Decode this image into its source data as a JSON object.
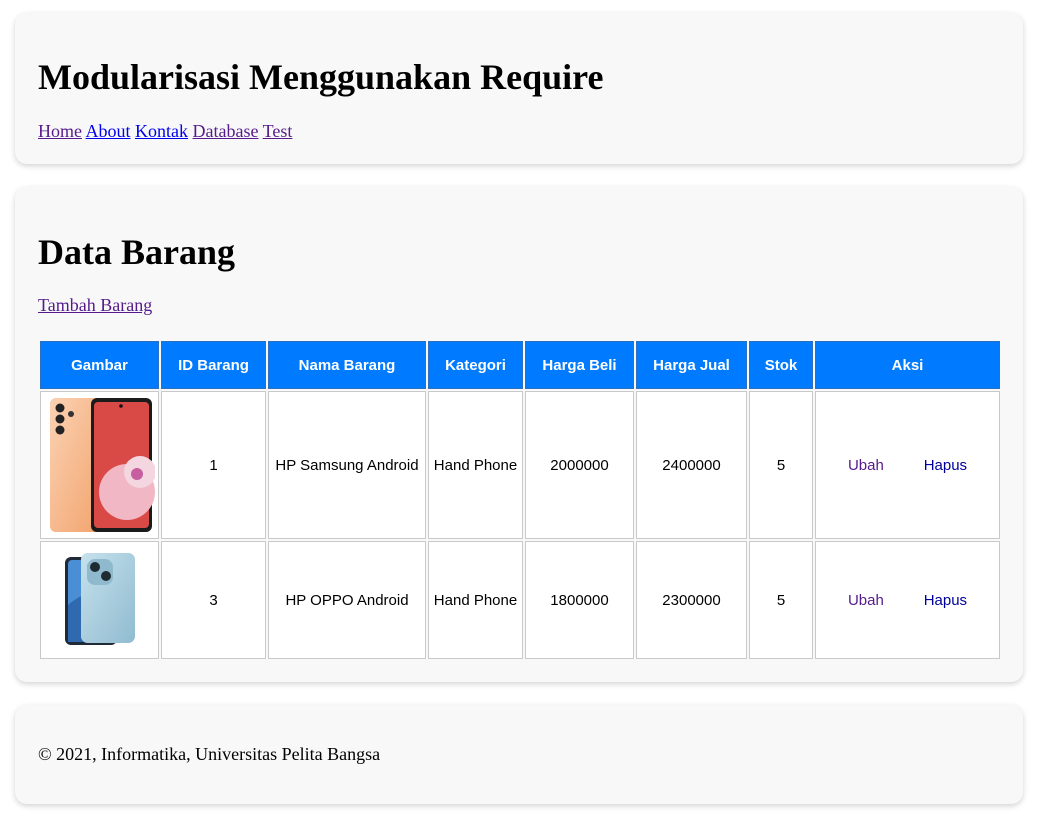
{
  "header": {
    "title": "Modularisasi Menggunakan Require",
    "nav": [
      {
        "label": "Home"
      },
      {
        "label": "About"
      },
      {
        "label": "Kontak"
      },
      {
        "label": "Database"
      },
      {
        "label": "Test"
      }
    ]
  },
  "main": {
    "title": "Data Barang",
    "add_link": "Tambah Barang",
    "table": {
      "headers": [
        "Gambar",
        "ID Barang",
        "Nama Barang",
        "Kategori",
        "Harga Beli",
        "Harga Jual",
        "Stok",
        "Aksi"
      ],
      "rows": [
        {
          "id": "1",
          "nama": "HP Samsung Android",
          "kategori": "Hand Phone",
          "harga_beli": "2000000",
          "harga_jual": "2400000",
          "stok": "5",
          "ubah": "Ubah",
          "hapus": "Hapus"
        },
        {
          "id": "3",
          "nama": "HP OPPO Android",
          "kategori": "Hand Phone",
          "harga_beli": "1800000",
          "harga_jual": "2300000",
          "stok": "5",
          "ubah": "Ubah",
          "hapus": "Hapus"
        }
      ]
    }
  },
  "footer": {
    "text": "© 2021, Informatika, Universitas Pelita Bangsa"
  },
  "colors": {
    "table_header_bg": "#007bff",
    "card_bg": "#f8f8f8",
    "link_visited": "#551a8b",
    "link_unvisited": "#0000ee"
  }
}
